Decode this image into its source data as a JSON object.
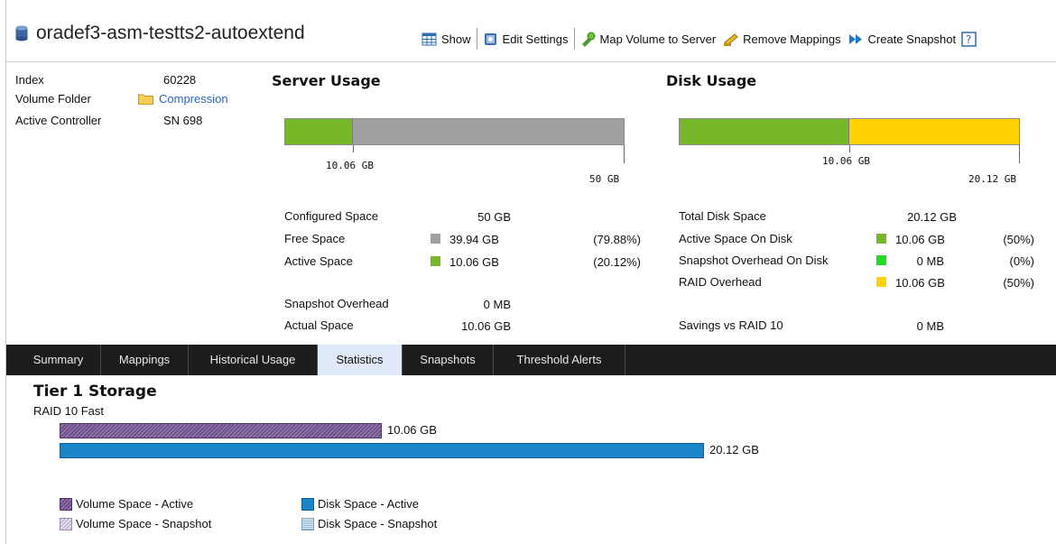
{
  "header": {
    "title": "oradef3-asm-testts2-autoextend",
    "actions": [
      {
        "label": "Show",
        "icon": "grid-show-icon"
      },
      {
        "label": "Edit Settings",
        "icon": "edit-settings-icon"
      },
      {
        "label": "Map Volume to Server",
        "icon": "map-volume-icon"
      },
      {
        "label": "Remove Mappings",
        "icon": "remove-mappings-icon"
      },
      {
        "label": "Create Snapshot",
        "icon": "create-snapshot-icon"
      }
    ]
  },
  "info": {
    "index_label": "Index",
    "index_value": "60228",
    "folder_label": "Volume Folder",
    "folder_value": "Compression",
    "controller_label": "Active Controller",
    "controller_value": "SN 698"
  },
  "server_usage": {
    "title": "Server Usage",
    "bar": {
      "used_fraction": 0.2012,
      "used_label": "10.06 GB",
      "total_label": "50 GB"
    },
    "rows": [
      {
        "label": "Configured Space",
        "value": "50 GB",
        "pct": ""
      },
      {
        "label": "Free Space",
        "value": "39.94 GB",
        "pct": "(79.88%)"
      },
      {
        "label": "Active Space",
        "value": "10.06 GB",
        "pct": "(20.12%)"
      },
      {
        "label": "Snapshot Overhead",
        "value": "0 MB",
        "pct": ""
      },
      {
        "label": "Actual Space",
        "value": "10.06 GB",
        "pct": ""
      }
    ]
  },
  "disk_usage": {
    "title": "Disk Usage",
    "bar": {
      "active_fraction": 0.5,
      "active_label": "10.06 GB",
      "total_label": "20.12 GB"
    },
    "rows": [
      {
        "label": "Total Disk Space",
        "value": "20.12 GB",
        "pct": ""
      },
      {
        "label": "Active Space On Disk",
        "value": "10.06 GB",
        "pct": "(50%)"
      },
      {
        "label": "Snapshot Overhead On Disk",
        "value": "0 MB",
        "pct": "(0%)"
      },
      {
        "label": "RAID Overhead",
        "value": "10.06 GB",
        "pct": "(50%)"
      },
      {
        "label": "Savings vs RAID 10",
        "value": "0 MB",
        "pct": ""
      }
    ]
  },
  "colors": {
    "active_green": "#77b82a",
    "free_gray": "#a0a0a0",
    "snapshot_green": "#22dd22",
    "raid_yellow": "#ffd200",
    "volume_purple": "#6e4f8a",
    "disk_blue": "#1a86c8"
  },
  "tabs": [
    {
      "label": "Summary",
      "active": false
    },
    {
      "label": "Mappings",
      "active": false
    },
    {
      "label": "Historical Usage",
      "active": false
    },
    {
      "label": "Statistics",
      "active": true
    },
    {
      "label": "Snapshots",
      "active": false
    },
    {
      "label": "Threshold Alerts",
      "active": false
    }
  ],
  "tier": {
    "title": "Tier 1 Storage",
    "subtitle": "RAID 10 Fast",
    "volume_bar": {
      "value_gb": 10.06,
      "label": "10.06 GB"
    },
    "disk_bar": {
      "value_gb": 20.12,
      "label": "20.12 GB"
    },
    "legend": [
      {
        "label": "Volume Space - Active",
        "icon": "volume-active-swatch"
      },
      {
        "label": "Disk Space - Active",
        "icon": "disk-active-swatch"
      },
      {
        "label": "Volume Space - Snapshot",
        "icon": "volume-snapshot-swatch"
      },
      {
        "label": "Disk Space - Snapshot",
        "icon": "disk-snapshot-swatch"
      }
    ]
  }
}
